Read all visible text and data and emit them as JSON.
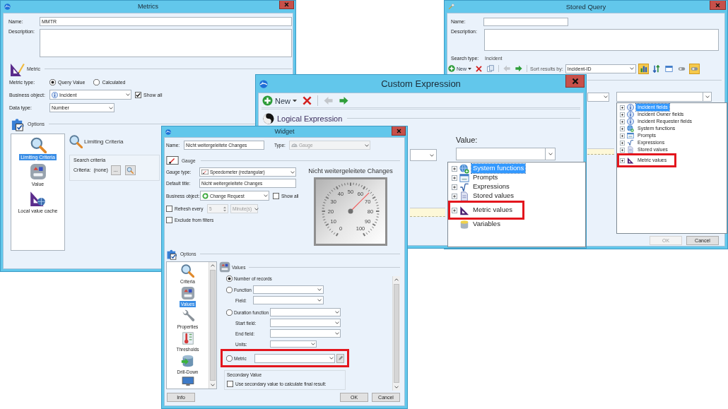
{
  "metrics_window": {
    "title": "Metrics",
    "name_label": "Name:",
    "name_value": "MMTR",
    "description_label": "Description:",
    "metric_section": "Metric",
    "metric_type_label": "Metric type:",
    "metric_types": [
      {
        "label": "Query Value",
        "selected": true
      },
      {
        "label": "Calculated",
        "selected": false
      }
    ],
    "business_object_label": "Business object:",
    "business_object": "Incident",
    "show_all": {
      "label": "Show all",
      "checked": true
    },
    "data_type_label": "Data type:",
    "data_type": "Number",
    "options_section": "Options",
    "options": [
      {
        "label": "Limiting Criteria",
        "kind": "search",
        "selected": true
      },
      {
        "label": "Value",
        "kind": "tile",
        "selected": false
      },
      {
        "label": "Local value cache",
        "kind": "cache",
        "selected": false
      }
    ],
    "panel_title": "Limiting Criteria",
    "search_criteria": {
      "title": "Search criteria",
      "label": "Criteria:",
      "value": "(none)",
      "browse_button": "..."
    }
  },
  "stored_query_window": {
    "title": "Stored Query",
    "name_label": "Name:",
    "description_label": "Description:",
    "search_type_label": "Search type:",
    "search_type": "Incident",
    "toolbar": {
      "new_button": "New",
      "nav": [
        {
          "kind": "back",
          "disabled": true
        },
        {
          "kind": "forward",
          "disabled": false
        }
      ],
      "sort_label": "Sort results by:",
      "sort_value": "Incident-ID",
      "toggles": [
        {
          "kind": "chart",
          "on": true
        },
        {
          "kind": "sort",
          "on": false
        },
        {
          "kind": "window",
          "on": false
        },
        {
          "kind": "pill",
          "on": false
        },
        {
          "kind": "pill",
          "on": true
        }
      ]
    },
    "value_list": [
      {
        "label": "Incident fields",
        "kind": "info",
        "expandable": true,
        "selected": true,
        "highlighted": false
      },
      {
        "label": "Incident Owner fields",
        "kind": "info",
        "expandable": true,
        "selected": false,
        "highlighted": false
      },
      {
        "label": "Incident Requester fields",
        "kind": "info",
        "expandable": true,
        "selected": false,
        "highlighted": false
      },
      {
        "label": "System functions",
        "kind": "globe",
        "expandable": true,
        "selected": false,
        "highlighted": false
      },
      {
        "label": "Prompts",
        "kind": "window",
        "expandable": true,
        "selected": false,
        "highlighted": false
      },
      {
        "label": "Expressions",
        "kind": "root",
        "expandable": true,
        "selected": false,
        "highlighted": false
      },
      {
        "label": "Stored values",
        "kind": "document",
        "expandable": true,
        "selected": false,
        "highlighted": false
      },
      {
        "label": "Metric values",
        "kind": "set-square",
        "expandable": true,
        "selected": false,
        "highlighted": true
      }
    ],
    "buttons": [
      {
        "label": "OK",
        "disabled": true
      },
      {
        "label": "Cancel",
        "disabled": false
      }
    ]
  },
  "custom_expression_window": {
    "title": "Custom Expression",
    "toolbar": {
      "new_button": "New",
      "nav": [
        {
          "kind": "back",
          "disabled": true
        },
        {
          "kind": "forward",
          "disabled": false
        }
      ]
    },
    "section": "Logical Expression",
    "value_label": "Value:",
    "value_list": [
      {
        "label": "System functions",
        "kind": "globe",
        "expandable": true,
        "selected": true,
        "highlighted": false
      },
      {
        "label": "Prompts",
        "kind": "window",
        "expandable": true,
        "selected": false,
        "highlighted": false
      },
      {
        "label": "Expressions",
        "kind": "root",
        "expandable": true,
        "selected": false,
        "highlighted": false
      },
      {
        "label": "Stored values",
        "kind": "document",
        "expandable": true,
        "selected": false,
        "highlighted": false
      },
      {
        "label": "Metric values",
        "kind": "set-square",
        "expandable": true,
        "selected": false,
        "highlighted": true
      },
      {
        "label": "Variables",
        "kind": "cylinder",
        "expandable": false,
        "selected": false,
        "highlighted": false
      }
    ]
  },
  "widget_window": {
    "title": "Widget",
    "name_label": "Name:",
    "name_value": "Nicht weitergeleitete Changes",
    "type_label": "Type:",
    "type": {
      "value": "Gauge",
      "disabled": true
    },
    "gauge_section": "Gauge",
    "gauge_type_label": "Gauge type:",
    "gauge_type": "Speedometer (rectangular)",
    "default_title_label": "Default title:",
    "default_title": "Nicht weitergeleitete Changes",
    "business_object_label": "Business object:",
    "business_object": "Change Request",
    "show_all": {
      "label": "Show all",
      "checked": false
    },
    "refresh": {
      "label": "Refresh every",
      "checked": false,
      "interval": "5",
      "unit": "Minute(s)"
    },
    "exclude_filters": {
      "label": "Exclude from filters",
      "checked": false
    },
    "preview": {
      "title": "Nicht weitergeleitete Changes",
      "scale_labels": [
        "0",
        "10",
        "20",
        "30",
        "40",
        "50",
        "60",
        "70",
        "80",
        "90",
        "100"
      ],
      "level": 0.65
    },
    "options_section": "Options",
    "options": [
      {
        "label": "Criteria",
        "kind": "search",
        "selected": false
      },
      {
        "label": "Values",
        "kind": "tile",
        "selected": true
      },
      {
        "label": "Properties",
        "kind": "wrench",
        "selected": false
      },
      {
        "label": "Thresholds",
        "kind": "thermometer",
        "selected": false
      },
      {
        "label": "Drill-Down",
        "kind": "drill",
        "selected": false
      },
      {
        "kind": "monitor",
        "selected": false
      }
    ],
    "values_title": "Values",
    "value_types": [
      {
        "label": "Number of records",
        "kind": "plain",
        "selected": true,
        "highlighted": false
      },
      {
        "label": "Function",
        "kind": "select",
        "selected": false,
        "highlighted": false,
        "fields": [
          "Field:"
        ]
      },
      {
        "label": "Duration function",
        "kind": "select",
        "selected": false,
        "highlighted": false,
        "fields": [
          "Start field:",
          "End field:",
          "Units:"
        ]
      },
      {
        "label": "Metric",
        "kind": "metric",
        "selected": false,
        "highlighted": true
      }
    ],
    "secondary": {
      "title": "Secondary Value",
      "label": "Use secondary value to calculate final result:",
      "checked": false
    },
    "buttons": [
      "Info",
      "OK",
      "Cancel"
    ]
  }
}
